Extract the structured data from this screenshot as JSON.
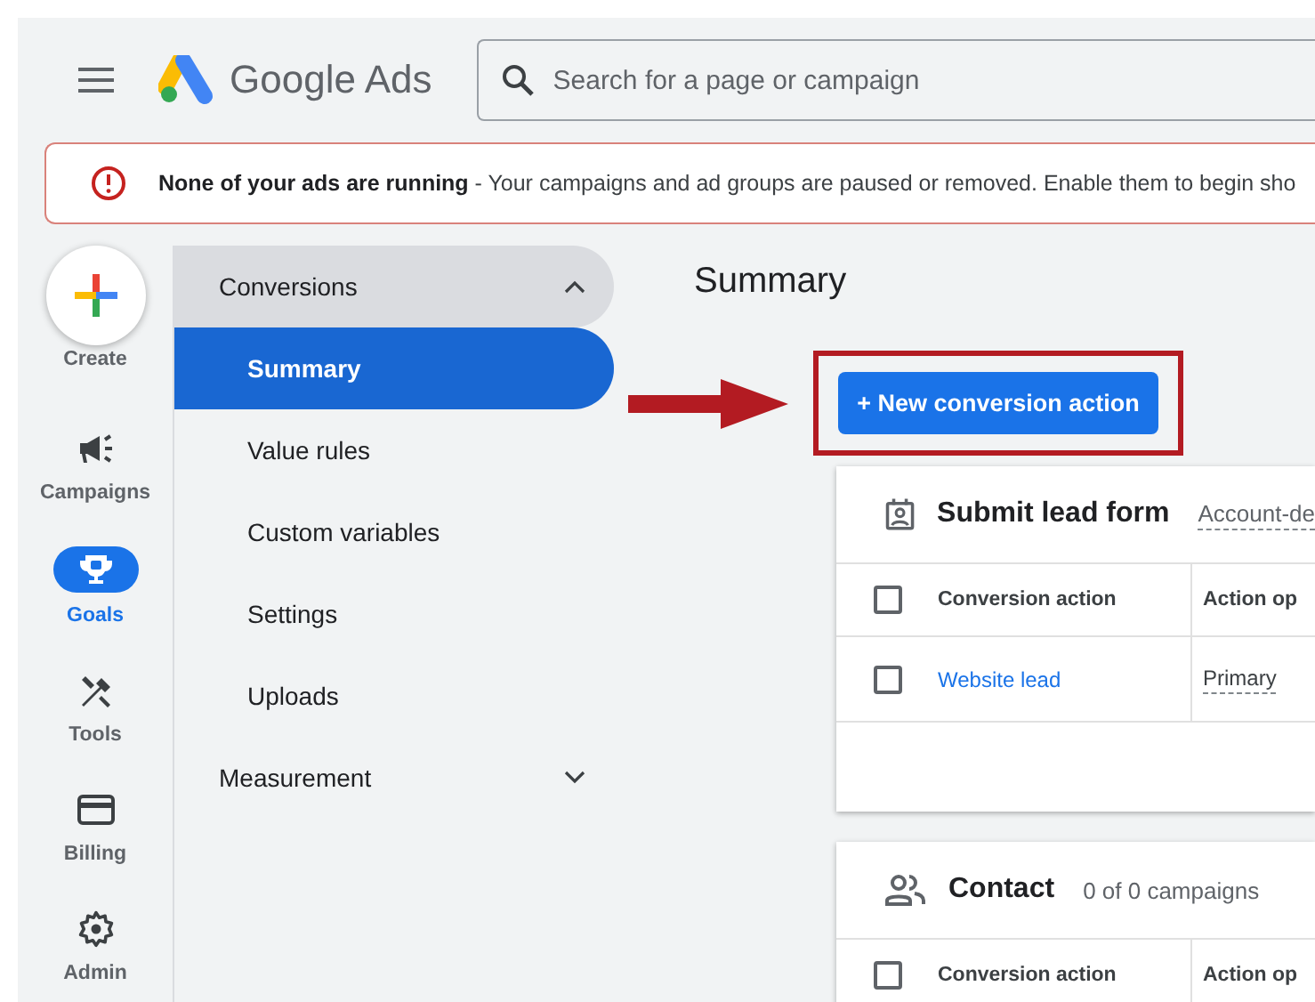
{
  "header": {
    "product_name": "Google Ads",
    "search": {
      "placeholder": "Search for a page or campaign"
    }
  },
  "alert": {
    "message": "**None of your ads are running** - Your campaigns and ad groups are paused or removed. Enable them to begin sho"
  },
  "rail": [
    {
      "label": "Create",
      "kind": "create",
      "selected": false
    },
    {
      "label": "Campaigns",
      "kind": "campaigns",
      "selected": false
    },
    {
      "label": "Goals",
      "kind": "goals",
      "selected": true
    },
    {
      "label": "Tools",
      "kind": "tools",
      "selected": false
    },
    {
      "label": "Billing",
      "kind": "billing",
      "selected": false
    },
    {
      "label": "Admin",
      "kind": "admin",
      "selected": false
    }
  ],
  "nav": [
    {
      "label": "Conversions",
      "expanded": true,
      "children": [
        {
          "label": "Summary",
          "selected": true
        },
        {
          "label": "Value rules",
          "selected": false
        },
        {
          "label": "Custom variables",
          "selected": false
        },
        {
          "label": "Settings",
          "selected": false
        },
        {
          "label": "Uploads",
          "selected": false
        }
      ]
    },
    {
      "label": "Measurement",
      "expanded": false
    }
  ],
  "page_title": "Summary",
  "primary_button": {
    "label": "+ New conversion action",
    "highlighted": true
  },
  "cards": [
    {
      "kind": "lead-form",
      "title": "Submit lead form",
      "subtitle": "Account-de",
      "subtitle_dashed": true,
      "select_all_checked": false,
      "columns": [
        "Conversion action",
        "Action op"
      ],
      "rows": [
        {
          "checked": false,
          "name": "Website lead",
          "optimization": "Primary"
        }
      ]
    },
    {
      "kind": "contact",
      "title": "Contact",
      "subtitle": "0 of 0 campaigns",
      "subtitle_dashed": false,
      "select_all_checked": false,
      "columns": [
        "Conversion action",
        "Action op"
      ]
    }
  ]
}
